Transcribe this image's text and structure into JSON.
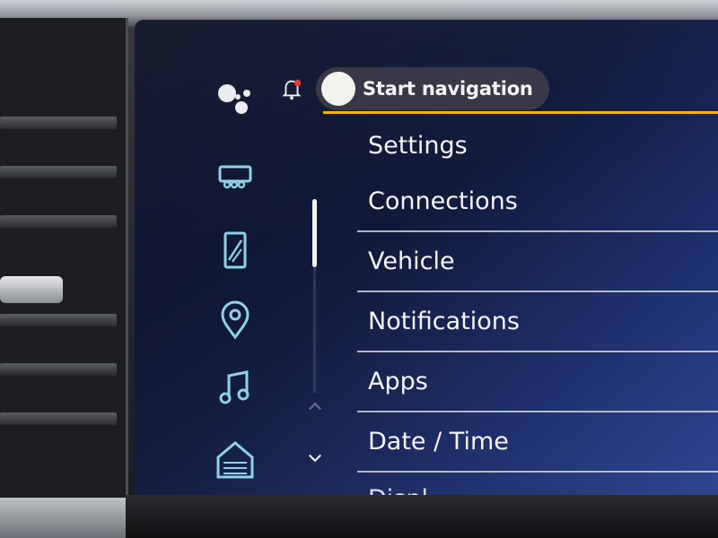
{
  "topbar": {
    "nav_button_label": "Start navigation"
  },
  "rail": {
    "icons": [
      {
        "name": "assistant-icon"
      },
      {
        "name": "vehicle-trailer-icon"
      },
      {
        "name": "phone-icon"
      },
      {
        "name": "location-icon"
      },
      {
        "name": "music-icon"
      },
      {
        "name": "home-icon"
      }
    ]
  },
  "settings_menu": {
    "header": "Settings",
    "items": [
      {
        "label": "Connections"
      },
      {
        "label": "Vehicle"
      },
      {
        "label": "Notifications"
      },
      {
        "label": "Apps"
      },
      {
        "label": "Date / Time"
      },
      {
        "label": "Displ"
      }
    ]
  },
  "colors": {
    "accent": "#f1b51b",
    "screen_bg": "#101a3a",
    "text": "#f4f5f8",
    "notification_dot": "#e53935"
  }
}
